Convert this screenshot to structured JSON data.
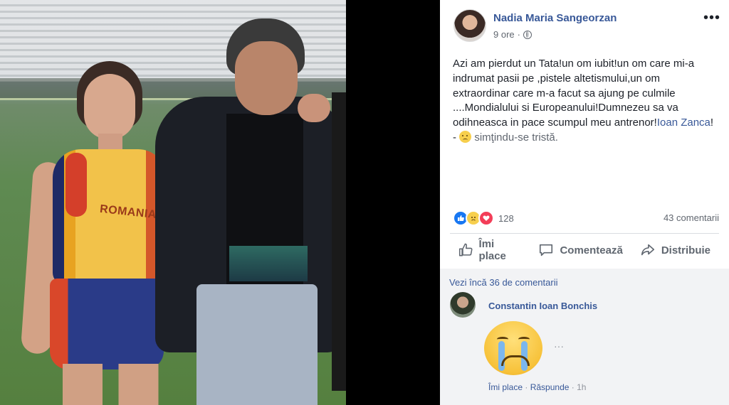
{
  "post": {
    "author": "Nadia Maria Sangeorzan",
    "time": "9 ore",
    "separator": "·",
    "more_label": "•••",
    "text_main": "Azi am pierdut un Tata!un om iubit!un om care mi-a indrumat pasii pe ,pistele altetismului,un om extraordinar care m-a facut sa ajung pe culmile ....Mondialului si Europeanului!Dumnezeu sa va odihneasca in pace scumpul meu antrenor!",
    "tagged_name": "Ioan Zanca",
    "text_after": "! - ",
    "feeling": "simţindu-se tristă."
  },
  "reactions": {
    "count": "128",
    "comments": "43 comentarii"
  },
  "actions": {
    "like": "Îmi place",
    "comment": "Comentează",
    "share": "Distribuie"
  },
  "comments": {
    "more": "Vezi încă 36 de comentarii",
    "item": {
      "author": "Constantin Ioan Bonchis",
      "more": "···",
      "like": "Îmi place",
      "reply": "Răspunde",
      "dot": "·",
      "time": "1h"
    }
  },
  "photo": {
    "jersey_text": "ROMANIA"
  },
  "colors": {
    "link": "#385898",
    "like_blue": "#1877f2",
    "love_red": "#f33e58"
  }
}
